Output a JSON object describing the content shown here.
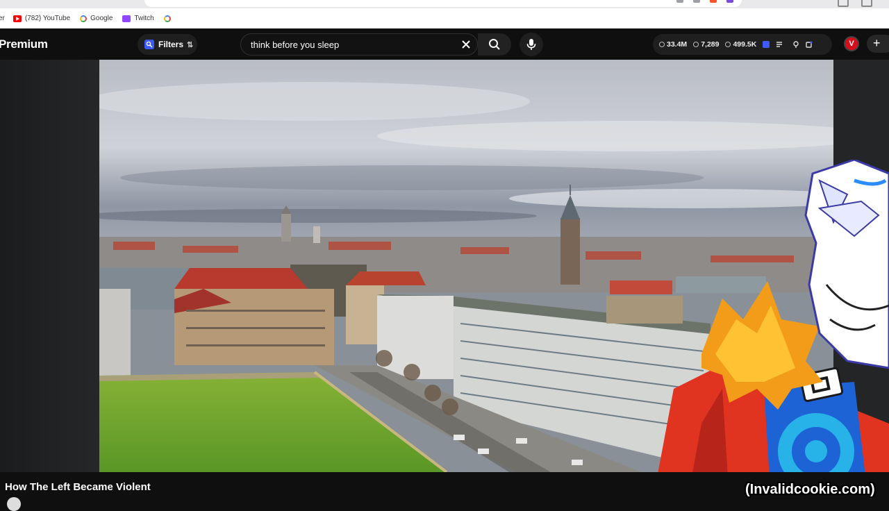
{
  "bookmarks": [
    {
      "label": "er",
      "icon": "none"
    },
    {
      "label": "(782) YouTube",
      "icon": "youtube-icon"
    },
    {
      "label": "Google",
      "icon": "google-icon"
    },
    {
      "label": "Twitch",
      "icon": "twitch-icon"
    },
    {
      "label": "",
      "icon": "google-icon"
    }
  ],
  "masthead": {
    "logo_text": "Premium",
    "filters_label": "Filters",
    "search_value": "think before you sleep"
  },
  "stats": {
    "views": "33.4M",
    "likes": "7,289",
    "watching": "499.5K"
  },
  "account": {
    "avatar_letter": "V"
  },
  "video": {
    "title": "How The Left Became Violent",
    "watermark": "(Invalidcookie.com)"
  },
  "colors": {
    "background": "#0f0f0f",
    "youtube_red": "#ff0000",
    "avatar_red": "#d60d1a",
    "grass": "#6ea82c",
    "roof_red": "#b83a2e"
  }
}
